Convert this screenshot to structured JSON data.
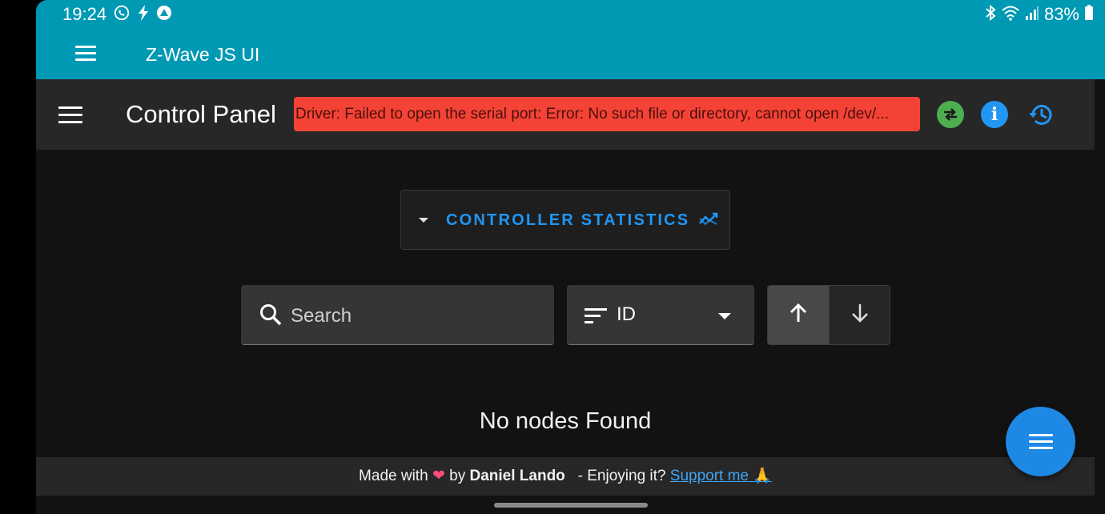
{
  "status_bar": {
    "time": "19:24",
    "battery": "83%",
    "left_icons": [
      "whatsapp-icon",
      "bolt-icon",
      "arc-icon"
    ],
    "right_icons": [
      "bluetooth-icon",
      "wifi-icon",
      "signal-icon",
      "battery-icon"
    ]
  },
  "app_bar": {
    "title": "Z-Wave JS UI"
  },
  "toolbar": {
    "title": "Control Panel",
    "error_message": "Driver: Failed to open the serial port: Error: No such file or directory, cannot open /dev/...",
    "icons": [
      "swap-icon",
      "info-icon",
      "history-icon"
    ]
  },
  "controller_stats": {
    "label": "CONTROLLER STATISTICS"
  },
  "search": {
    "placeholder": "Search"
  },
  "sort": {
    "value": "ID",
    "direction": "ascending"
  },
  "empty_state": {
    "message": "No nodes Found"
  },
  "footer": {
    "made_with": "Made with",
    "by": "by",
    "author": "Daniel Lando",
    "enjoying": "- Enjoying it?",
    "support_link": "Support me",
    "heart_glyph": "❤",
    "pray_glyph": "🙏"
  },
  "colors": {
    "app_bar": "#0099b4",
    "error": "#f44336",
    "accent": "#2196f3",
    "success": "#4caf50"
  }
}
